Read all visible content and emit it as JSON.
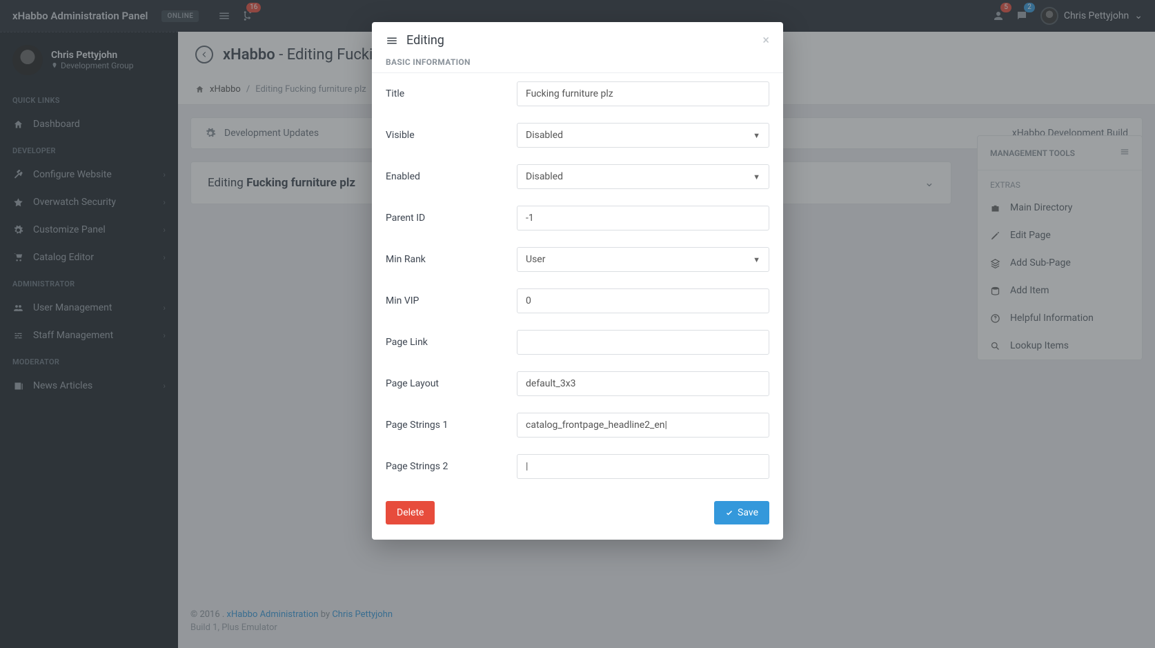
{
  "topbar": {
    "brand": "xHabbo Administration Panel",
    "online_label": "ONLINE",
    "notif_count": "16",
    "user_badge": "5",
    "chat_badge": "2",
    "username": "Chris Pettyjohn"
  },
  "sidebar": {
    "user": {
      "name": "Chris Pettyjohn",
      "group": "Development Group"
    },
    "sections": {
      "quick": "QUICK LINKS",
      "dev": "DEVELOPER",
      "admin": "ADMINISTRATOR",
      "mod": "MODERATOR"
    },
    "items": {
      "dashboard": "Dashboard",
      "configure": "Configure Website",
      "overwatch": "Overwatch Security",
      "customize": "Customize Panel",
      "catalog": "Catalog Editor",
      "usermgmt": "User Management",
      "staffmgmt": "Staff Management",
      "news": "News Articles"
    }
  },
  "page": {
    "title_prefix": "xHabbo",
    "title_suffix": " - Editing Fucking furniture plz",
    "breadcrumb_root": "xHabbo",
    "breadcrumb_current": "Editing Fucking furniture plz",
    "dev_updates": "Development Updates",
    "dev_build": "xHabbo Development Build",
    "editing_prefix": "Editing ",
    "editing_bold": "Fucking furniture plz"
  },
  "tools": {
    "header": "MANAGEMENT TOOLS",
    "extras": "EXTRAS",
    "items": {
      "maindir": "Main Directory",
      "editpage": "Edit Page",
      "addsub": "Add Sub-Page",
      "additem": "Add Item",
      "help": "Helpful Information",
      "lookup": "Lookup Items"
    }
  },
  "footer": {
    "copyright": "© 2016 . ",
    "link1": "xHabbo Administration",
    "by": " by ",
    "link2": "Chris Pettyjohn",
    "build": "Build 1, Plus Emulator"
  },
  "modal": {
    "title": "Editing",
    "section": "BASIC INFORMATION",
    "labels": {
      "title": "Title",
      "visible": "Visible",
      "enabled": "Enabled",
      "parentid": "Parent ID",
      "minrank": "Min Rank",
      "minvip": "Min VIP",
      "pagelink": "Page Link",
      "pagelayout": "Page Layout",
      "ps1": "Page Strings 1",
      "ps2": "Page Strings 2"
    },
    "values": {
      "title": "Fucking furniture plz",
      "visible": "Disabled",
      "enabled": "Disabled",
      "parentid": "-1",
      "minrank": "User",
      "minvip": "0",
      "pagelink": "",
      "pagelayout": "default_3x3",
      "ps1": "catalog_frontpage_headline2_en|",
      "ps2": "|"
    },
    "delete": "Delete",
    "save": "Save"
  }
}
